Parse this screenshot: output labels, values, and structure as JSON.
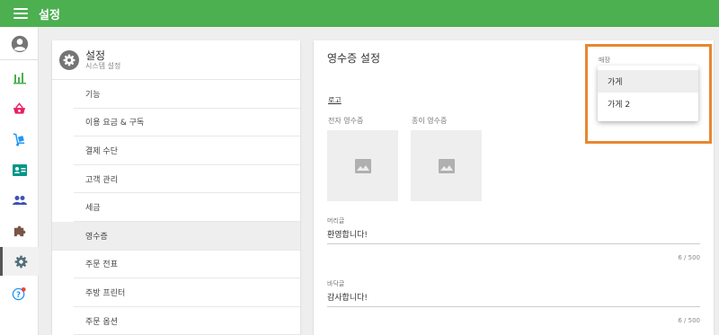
{
  "app": {
    "title": "설정"
  },
  "rail": {
    "icons": [
      "account-circle-icon",
      "bar-chart-icon",
      "basket-icon",
      "dolly-icon",
      "id-card-icon",
      "people-icon",
      "puzzle-icon",
      "gear-icon",
      "help-icon"
    ],
    "colors": {
      "chart": "#4caf50",
      "basket": "#e91e63",
      "dolly": "#2196f3",
      "card": "#009688",
      "people": "#3f51b5",
      "puzzle": "#795548",
      "gear": "#546e7a",
      "help": "#2196f3",
      "badge": "#f44336"
    }
  },
  "menu": {
    "title": "설정",
    "subtitle": "시스템 설정",
    "items": [
      {
        "label": "기능"
      },
      {
        "label": "이용 요금 & 구독"
      },
      {
        "label": "결제 수단"
      },
      {
        "label": "고객 관리"
      },
      {
        "label": "세금"
      },
      {
        "label": "영수증",
        "active": true
      },
      {
        "label": "주문 전표"
      },
      {
        "label": "주방 프린터"
      },
      {
        "label": "주문 옵션"
      }
    ]
  },
  "panel": {
    "title": "영수증 설정",
    "logo_section": "로고",
    "electronic_receipt_label": "전자 영수증",
    "paper_receipt_label": "종이 영수증",
    "header_label": "머리글",
    "header_value": "환영합니다!",
    "header_count": "6 / 500",
    "footer_label": "바닥글",
    "footer_value": "감사합니다!",
    "footer_count": "6 / 500"
  },
  "store_select": {
    "label": "매장",
    "options": [
      "가게",
      "가게 2"
    ],
    "highlighted": "가게"
  },
  "colors": {
    "topbar": "#4caf50",
    "highlight": "#e8872f"
  }
}
